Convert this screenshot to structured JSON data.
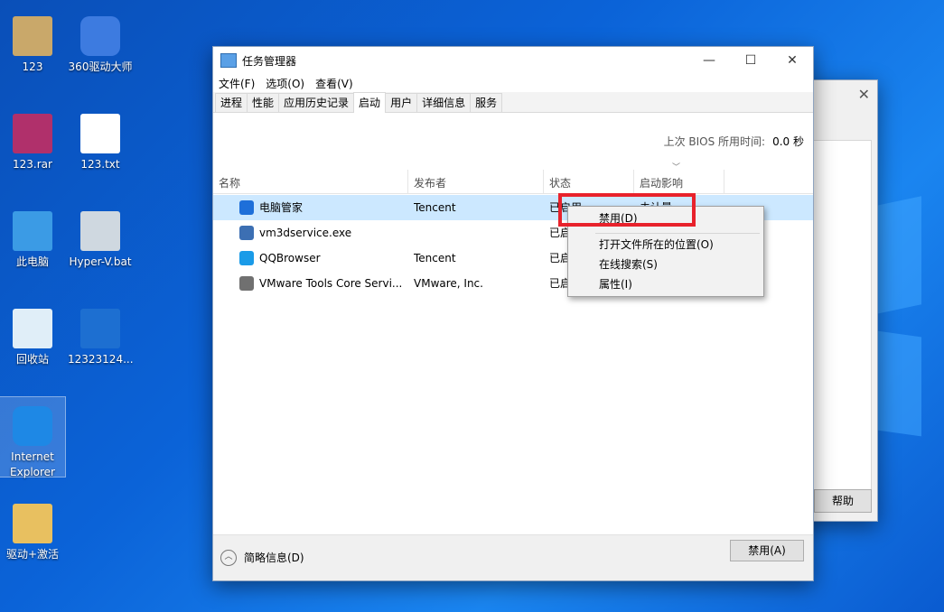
{
  "desktop": {
    "icons": [
      {
        "label": "123",
        "name": "desktop-icon-123-folder"
      },
      {
        "label": "360驱动大师",
        "name": "desktop-icon-360-driver"
      },
      {
        "label": "123.rar",
        "name": "desktop-icon-123-rar"
      },
      {
        "label": "123.txt",
        "name": "desktop-icon-123-txt"
      },
      {
        "label": "此电脑",
        "name": "desktop-icon-this-pc"
      },
      {
        "label": "Hyper-V.bat",
        "name": "desktop-icon-hyperv-bat"
      },
      {
        "label": "回收站",
        "name": "desktop-icon-recycle-bin"
      },
      {
        "label": "12323124...",
        "name": "desktop-icon-12323124"
      },
      {
        "label": "Internet Explorer",
        "name": "desktop-icon-internet-explorer"
      },
      {
        "label": "驱动+激活",
        "name": "desktop-icon-driver-activate"
      }
    ]
  },
  "back_window": {
    "help_label": "帮助"
  },
  "task_manager": {
    "title": "任务管理器",
    "menu": [
      "文件(F)",
      "选项(O)",
      "查看(V)"
    ],
    "tabs": [
      "进程",
      "性能",
      "应用历史记录",
      "启动",
      "用户",
      "详细信息",
      "服务"
    ],
    "active_tab": "启动",
    "bios_label": "上次 BIOS 所用时间:",
    "bios_value": "0.0 秒",
    "columns": [
      "名称",
      "发布者",
      "状态",
      "启动影响"
    ],
    "rows": [
      {
        "name": "电脑管家",
        "publisher": "Tencent",
        "status": "已启用",
        "impact": "未计量",
        "icon": "tencent-pc-manager-icon",
        "color": "#1e6fd9"
      },
      {
        "name": "vm3dservice.exe",
        "publisher": "",
        "status": "已启",
        "impact": "",
        "icon": "exe-file-icon",
        "color": "#3c6fb3"
      },
      {
        "name": "QQBrowser",
        "publisher": "Tencent",
        "status": "已启",
        "impact": "",
        "icon": "qqbrowser-icon",
        "color": "#1a9be8"
      },
      {
        "name": "VMware Tools Core Servi...",
        "publisher": "VMware, Inc.",
        "status": "已启",
        "impact": "",
        "icon": "vmware-icon",
        "color": "#707070"
      }
    ],
    "context_menu": [
      "禁用(D)",
      "打开文件所在的位置(O)",
      "在线搜索(S)",
      "属性(I)"
    ],
    "fewer_details": "简略信息(D)",
    "disable_button": "禁用(A)"
  }
}
